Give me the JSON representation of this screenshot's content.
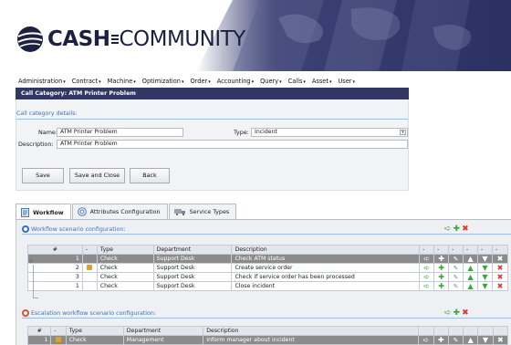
{
  "brand": {
    "logo_main": "CASH",
    "logo_sub": "COMMUNITY"
  },
  "menu": [
    "Administration",
    "Contract",
    "Machine",
    "Optimization",
    "Order",
    "Accounting",
    "Query",
    "Calls",
    "Asset",
    "User"
  ],
  "title_bar": "Call Category: ATM Printer Problem",
  "details": {
    "section_label": "Call category details:",
    "name_label": "Name:",
    "name_value": "ATM Printer Problem",
    "type_label": "Type:",
    "type_value": "Incident",
    "description_label": "Description:",
    "description_value": "ATM Printer Problem"
  },
  "buttons": {
    "save": "Save",
    "save_close": "Save and Close",
    "back": "Back"
  },
  "tabs": [
    {
      "label": "Workflow",
      "icon": "workflow-doc-icon",
      "active": true
    },
    {
      "label": "Attributes Configuration",
      "icon": "gear-circle-icon",
      "active": false
    },
    {
      "label": "Service Types",
      "icon": "truck-icon",
      "active": false
    }
  ],
  "workflow": {
    "section_label": "Workflow scenario configuration:",
    "columns": [
      "#",
      "-",
      "Type",
      "Department",
      "Description",
      "-",
      "-",
      "-",
      "-",
      "-",
      "-"
    ],
    "rows": [
      {
        "num": "1",
        "locked": false,
        "type": "Check",
        "department": "Support Desk",
        "description": "Check ATM status",
        "selected": true
      },
      {
        "num": "2",
        "locked": true,
        "type": "Check",
        "department": "Support Desk",
        "description": "Create service order",
        "selected": false
      },
      {
        "num": "3",
        "locked": false,
        "type": "Check",
        "department": "Support Desk",
        "description": "Check if service order has been processed",
        "selected": false
      },
      {
        "num": "1",
        "locked": false,
        "type": "Check",
        "department": "Support Desk",
        "description": "Close incident",
        "selected": false
      }
    ]
  },
  "escalation": {
    "section_label": "Escalation workflow scenario configuration:",
    "columns": [
      "#",
      "-",
      "Type",
      "Department",
      "Description"
    ],
    "rows": [
      {
        "num": "1",
        "type": "Check",
        "department": "Management",
        "description": "Inform manager about incident",
        "selected": true
      }
    ]
  },
  "colors": {
    "title_bar": "#323762",
    "link_blue": "#3f72ba",
    "selected_row": "#8b8b8b",
    "add_green": "#3aa53a",
    "delete_red": "#d93a2b"
  }
}
